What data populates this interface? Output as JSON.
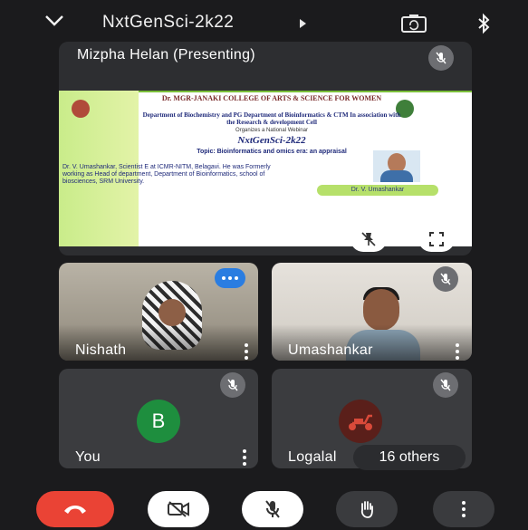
{
  "meeting": {
    "title": "NxtGenSci-2k22"
  },
  "presenter": {
    "label": "Mizpha Helan (Presenting)"
  },
  "slide": {
    "college": "Dr. MGR-JANAKI COLLEGE OF ARTS & SCIENCE FOR WOMEN",
    "department": "Department of Biochemistry and PG Department of Bioinformatics & CTM In association with the Research & development Cell",
    "organises": "Organizes a National Webinar",
    "event": "NxtGenSci-2k22",
    "topic": "Topic: Bioinformatics and omics era: an appraisal",
    "speaker_bio": "Dr. V. Umashankar, Scientist E at ICMR-NITM, Belagavi. He was Formerly working as Head of department, Department of Bioinformatics, school of biosciences, SRM University.",
    "speaker_tag": "Dr. V. Umashankar"
  },
  "participants": [
    {
      "name": "Nishath"
    },
    {
      "name": "Umashankar"
    },
    {
      "name": "You",
      "initial": "B"
    },
    {
      "name": "Logalal"
    }
  ],
  "others_label": "16 others",
  "colors": {
    "background": "#1b1b1d",
    "tile": "#3b3c3f",
    "end_call": "#ea4335",
    "avatar_b": "#1e8e3e",
    "accent_blue": "#2a7de1"
  },
  "icons": {
    "back": "chevron-down-icon",
    "meeting_info": "caret-right-icon",
    "switch_camera": "switch-camera-icon",
    "bluetooth": "bluetooth-icon",
    "mic_off": "mic-off-icon",
    "pin": "pin-icon",
    "fullscreen": "fullscreen-icon",
    "kebab": "more-vertical-icon",
    "end_call": "phone-hangup-icon",
    "camera_off": "camera-off-icon",
    "raise_hand": "hand-icon"
  }
}
